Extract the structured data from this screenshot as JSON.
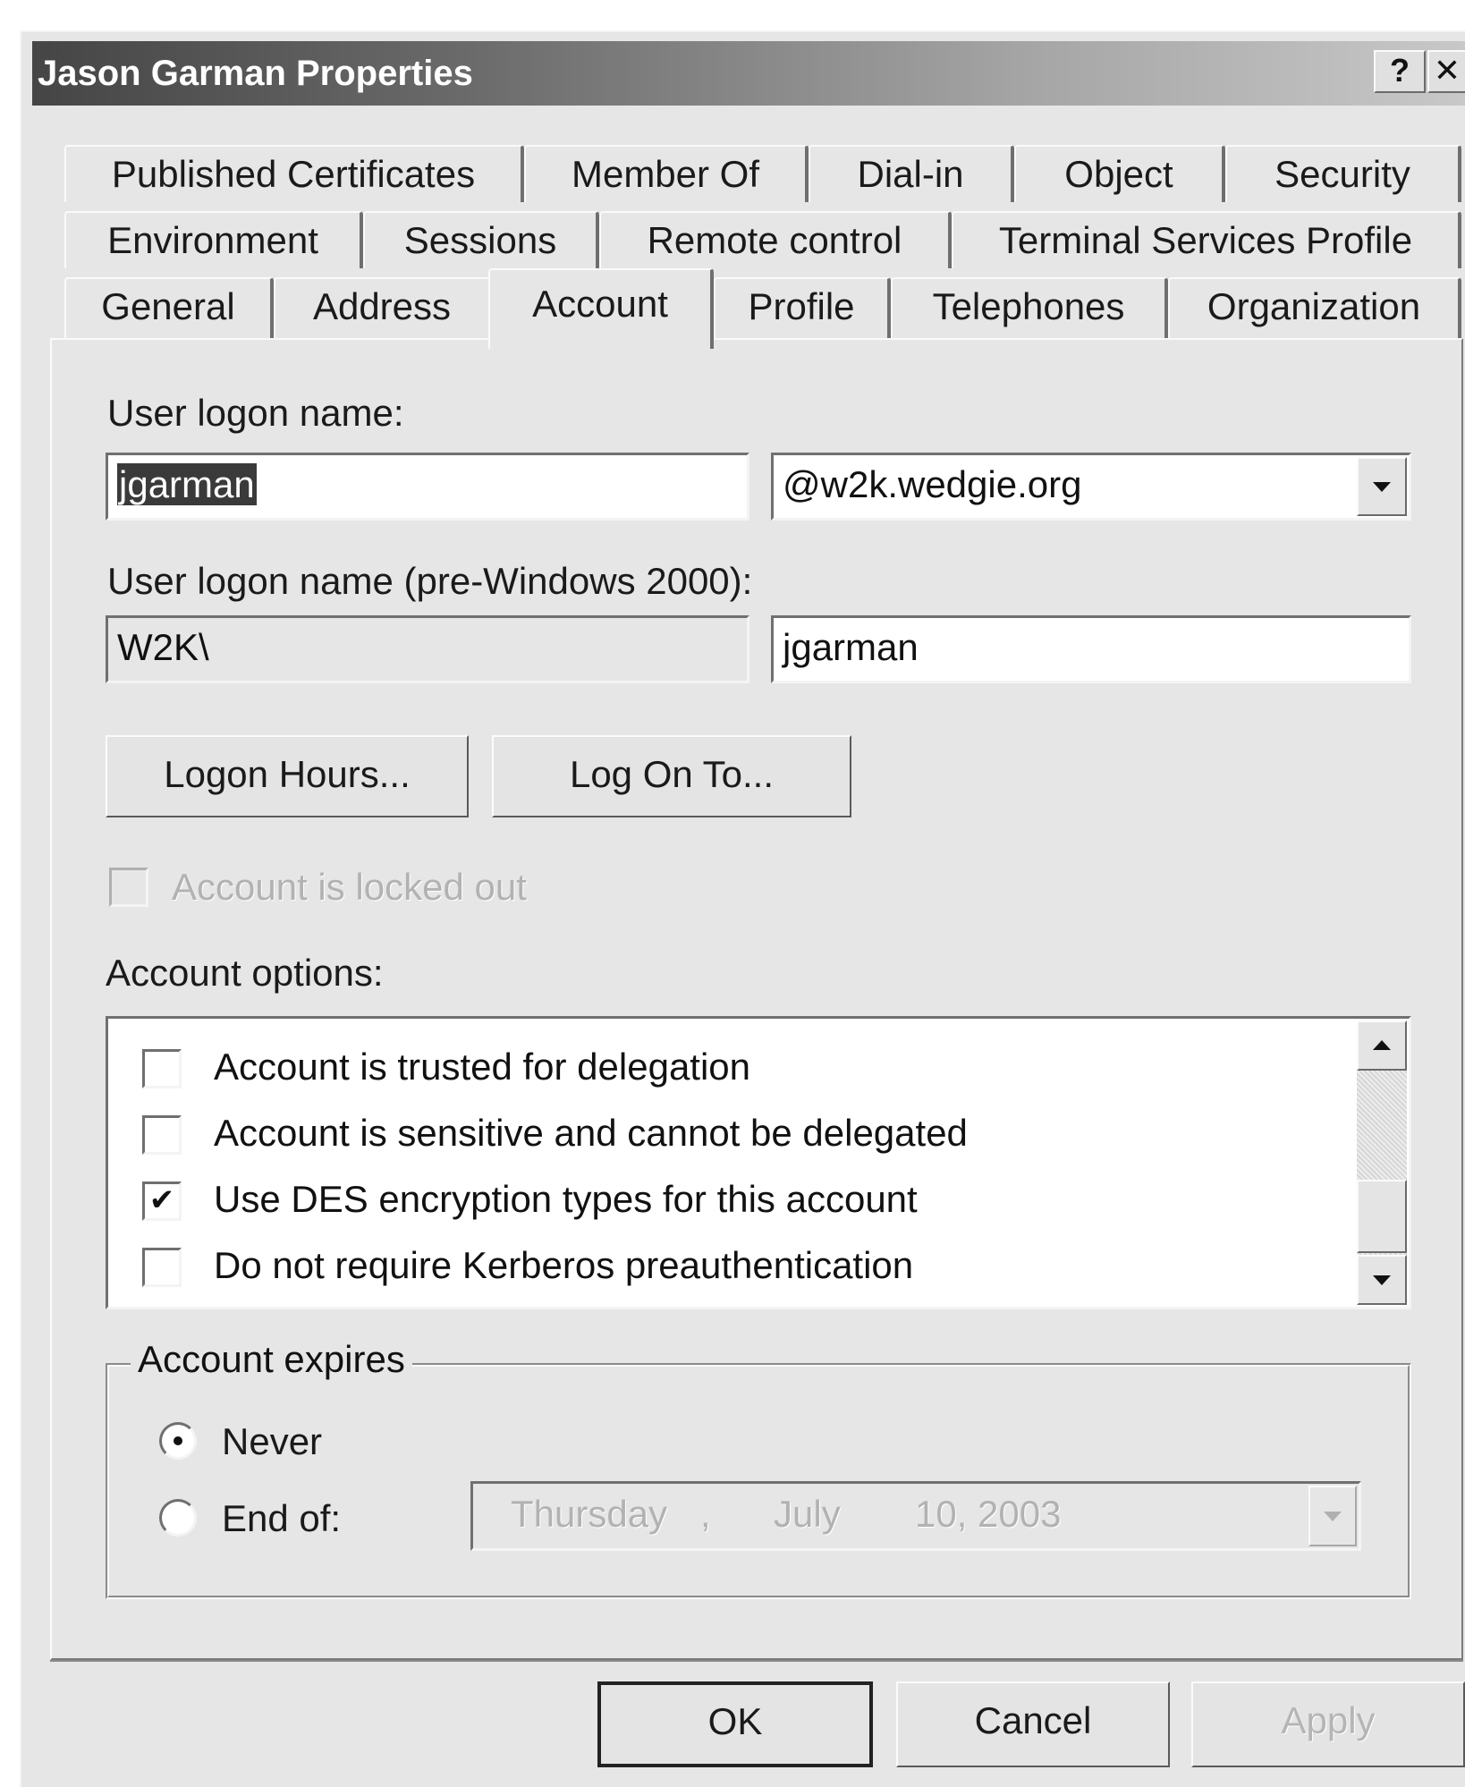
{
  "window": {
    "title": "Jason Garman Properties",
    "help_label": "?",
    "close_label": "✕"
  },
  "tabs": {
    "row1": [
      "Published Certificates",
      "Member Of",
      "Dial-in",
      "Object",
      "Security"
    ],
    "row2": [
      "Environment",
      "Sessions",
      "Remote control",
      "Terminal Services Profile"
    ],
    "row3": [
      "General",
      "Address",
      "Account",
      "Profile",
      "Telephones",
      "Organization"
    ],
    "active": "Account"
  },
  "account": {
    "logon_name_label": "User logon name:",
    "logon_name_value": "jgarman",
    "domain_value": "@w2k.wedgie.org",
    "pre2000_label": "User logon name (pre-Windows 2000):",
    "pre2000_domain": "W2K\\",
    "pre2000_user": "jgarman",
    "logon_hours_button": "Logon Hours...",
    "log_on_to_button": "Log On To...",
    "locked_out_label": "Account is locked out",
    "options_label": "Account options:",
    "options": [
      {
        "label": "Account is trusted for delegation",
        "checked": false
      },
      {
        "label": "Account is sensitive and cannot be delegated",
        "checked": false
      },
      {
        "label": "Use DES encryption types for this account",
        "checked": true
      },
      {
        "label": "Do not require Kerberos preauthentication",
        "checked": false
      }
    ],
    "expires": {
      "legend": "Account expires",
      "never_label": "Never",
      "end_of_label": "End of:",
      "selected": "Never",
      "date_day": "Thursday",
      "date_sep": ",",
      "date_month": "July",
      "date_rest": "10, 2003"
    }
  },
  "footer": {
    "ok": "OK",
    "cancel": "Cancel",
    "apply": "Apply"
  },
  "colors": {
    "dialog_bg": "#e6e6e6",
    "titlebar_dark": "#454545",
    "titlebar_light": "#c8c8c8"
  }
}
